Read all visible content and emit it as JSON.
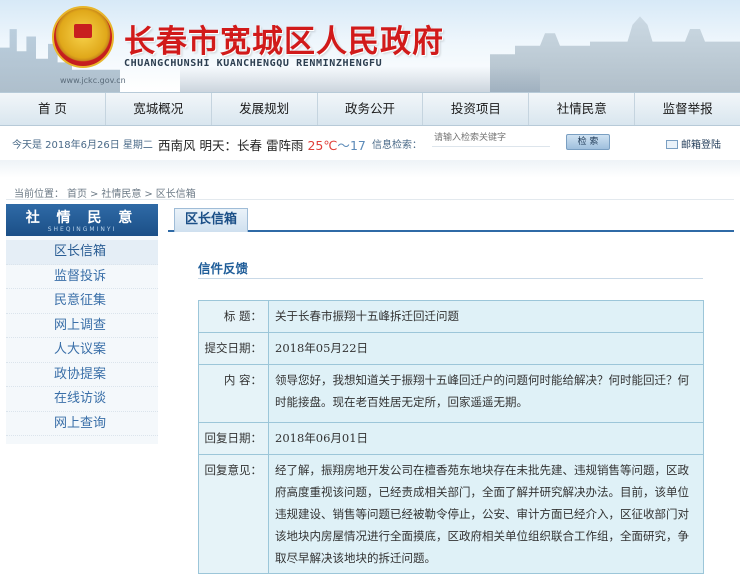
{
  "header": {
    "title": "长春市宽城区人民政府",
    "pinyin": "CHUANGCHUNSHI  KUANCHENGQU  RENMINZHENGFU",
    "url": "www.jckc.gov.cn",
    "colors": {
      "title": "#d11a1a",
      "nav_bg": "#e3ecf3",
      "accent": "#2f6aa6"
    }
  },
  "nav": {
    "items": [
      "首  页",
      "宽城概况",
      "发展规划",
      "政务公开",
      "投资项目",
      "社情民意",
      "监督举报"
    ]
  },
  "infobar": {
    "date": "今天是  2018年6月26日 星期二",
    "weather_prefix": "西南风",
    "weather_tomorrow": "明天：长春  雷阵雨",
    "temp_high": "25℃",
    "temp_sep": "～",
    "temp_low": "17",
    "search_label": "信息检索：",
    "search_placeholder": "请输入检索关键字",
    "search_button": "检  索",
    "mail_label": "邮箱登陆"
  },
  "breadcrumb": {
    "prefix": "当前位置：",
    "items": [
      "首页",
      "社情民意",
      "区长信箱"
    ],
    "separator": ">"
  },
  "sidebar": {
    "title": "社 情 民 意",
    "subtitle": "SHEQINGMINYI",
    "items": [
      "区长信箱",
      "监督投诉",
      "民意征集",
      "网上调查",
      "人大议案",
      "政协提案",
      "在线访谈",
      "网上查询"
    ]
  },
  "main": {
    "tab": "区长信箱",
    "section_title": "信件反馈",
    "letter": {
      "title_label": "标  题：",
      "title_value": "关于长春市振翔十五峰拆迁回迁问题",
      "date_label": "提交日期：",
      "date_value": "2018年05月22日",
      "content_label": "内  容：",
      "content_value": "领导您好，我想知道关于振翔十五峰回迁户的问题何时能给解决？何时能回迁？何时能接盘。现在老百姓居无定所，回家遥遥无期。",
      "reply_date_label": "回复日期：",
      "reply_date_value": "2018年06月01日",
      "reply_label": "回复意见：",
      "reply_value": "经了解，振翔房地开发公司在檀香苑东地块存在未批先建、违规销售等问题，区政府高度重视该问题，已经责成相关部门，全面了解并研究解决办法。目前，该单位违规建设、销售等问题已经被勒令停止，公安、审计方面已经介入，区征收部门对该地块内房屋情况进行全面摸底，区政府相关单位组织联合工作组，全面研究，争取尽早解决该地块的拆迁问题。"
    }
  }
}
